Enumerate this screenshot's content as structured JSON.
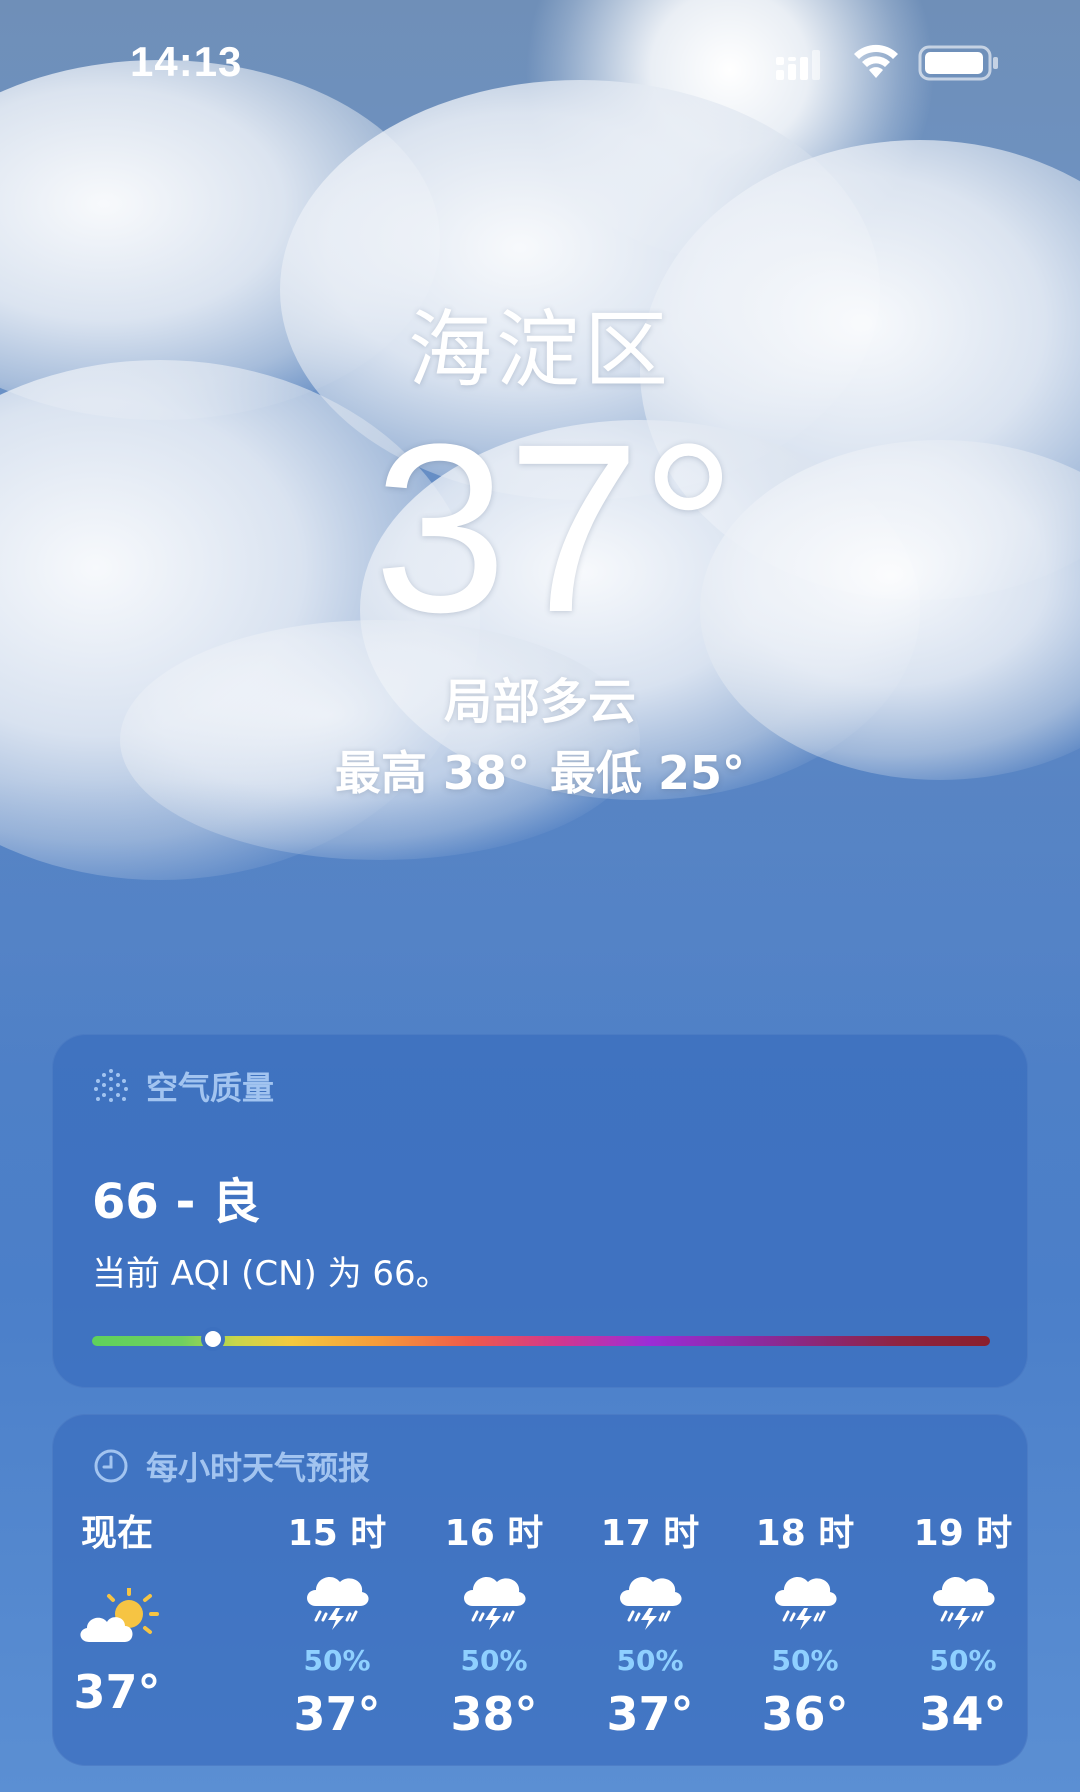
{
  "status_bar": {
    "time": "14:13"
  },
  "weather": {
    "location": "海淀区",
    "temperature": "37°",
    "condition": "局部多云",
    "high": "最高 38°",
    "low": "最低 25°"
  },
  "aqi": {
    "title": "空气质量",
    "value_label": "66 - 良",
    "description": "当前 AQI (CN) 为 66。",
    "value": 66,
    "marker_position": 0.135
  },
  "hourly": {
    "title": "每小时天气预报",
    "hours": [
      {
        "label": "现在",
        "icon": "partly-sunny-icon",
        "pop": "",
        "temp": "37°"
      },
      {
        "label": "15 时",
        "icon": "thunderstorm-icon",
        "pop": "50%",
        "temp": "37°"
      },
      {
        "label": "16 时",
        "icon": "thunderstorm-icon",
        "pop": "50%",
        "temp": "38°"
      },
      {
        "label": "17 时",
        "icon": "thunderstorm-icon",
        "pop": "50%",
        "temp": "37°"
      },
      {
        "label": "18 时",
        "icon": "thunderstorm-icon",
        "pop": "50%",
        "temp": "36°"
      },
      {
        "label": "19 时",
        "icon": "thunderstorm-icon",
        "pop": "50%",
        "temp": "34°"
      }
    ]
  },
  "colors": {
    "card_bg": "#3a6ebe",
    "header_text": "#adcdf5",
    "pop_text": "#8fd0ff"
  }
}
